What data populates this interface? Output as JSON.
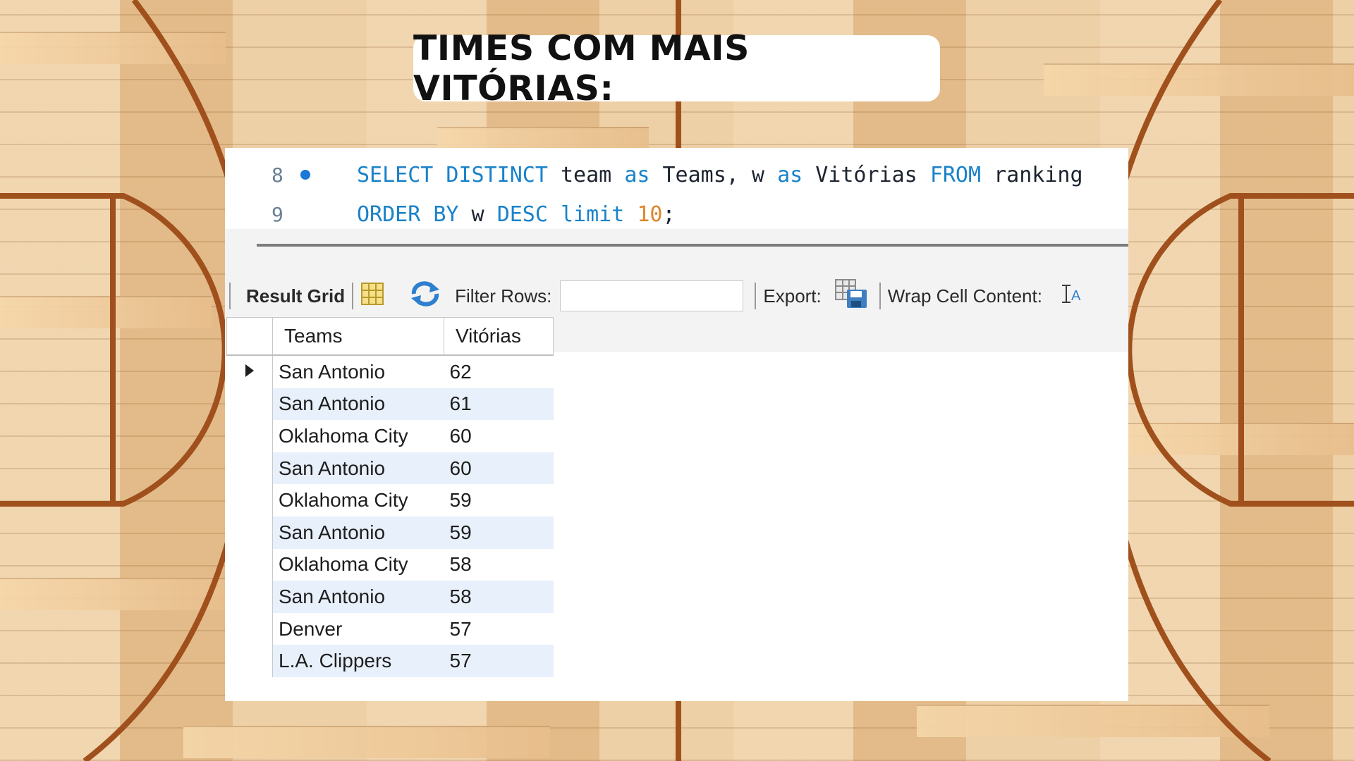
{
  "title": "TIMES COM MAIS VITÓRIAS:",
  "editor": {
    "lines": [
      {
        "number": "8",
        "has_bullet": true,
        "tokens": [
          {
            "text": "SELECT DISTINCT",
            "kind": "kw"
          },
          {
            "text": " team ",
            "kind": "id"
          },
          {
            "text": "as",
            "kind": "kw"
          },
          {
            "text": " Teams, w ",
            "kind": "id"
          },
          {
            "text": "as",
            "kind": "kw"
          },
          {
            "text": " Vitórias ",
            "kind": "id"
          },
          {
            "text": "FROM",
            "kind": "kw"
          },
          {
            "text": " ranking",
            "kind": "id"
          }
        ]
      },
      {
        "number": "9",
        "has_bullet": false,
        "tokens": [
          {
            "text": "ORDER BY",
            "kind": "kw"
          },
          {
            "text": " w ",
            "kind": "id"
          },
          {
            "text": "DESC limit",
            "kind": "kw"
          },
          {
            "text": " 10",
            "kind": "num"
          },
          {
            "text": ";",
            "kind": "id"
          }
        ]
      }
    ]
  },
  "toolbar": {
    "result_grid_label": "Result Grid",
    "filter_label": "Filter Rows:",
    "filter_value": "",
    "export_label": "Export:",
    "wrap_label": "Wrap Cell Content:"
  },
  "grid": {
    "columns": [
      "Teams",
      "Vitórias"
    ],
    "rows": [
      [
        "San Antonio",
        "62"
      ],
      [
        "San Antonio",
        "61"
      ],
      [
        "Oklahoma City",
        "60"
      ],
      [
        "San Antonio",
        "60"
      ],
      [
        "Oklahoma City",
        "59"
      ],
      [
        "San Antonio",
        "59"
      ],
      [
        "Oklahoma City",
        "58"
      ],
      [
        "San Antonio",
        "58"
      ],
      [
        "Denver",
        "57"
      ],
      [
        "L.A. Clippers",
        "57"
      ]
    ],
    "selected_row": 0
  },
  "colors": {
    "keyword": "#1a82c9",
    "number": "#e0852a",
    "alt_row": "#e8f0fb",
    "court_line": "#a0501c"
  }
}
